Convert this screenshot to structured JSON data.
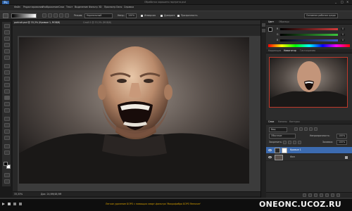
{
  "app": {
    "logo": "Ps",
    "title": "Обработка хорошего портрета.psd"
  },
  "window_controls": [
    "_",
    "□",
    "×"
  ],
  "menu": [
    "Файл",
    "Редактирование",
    "Изображение",
    "Слои",
    "Текст",
    "Выделение",
    "Фильтр",
    "3D",
    "Просмотр",
    "Окно",
    "Справка"
  ],
  "options_bar": {
    "mode_label": "Режим:",
    "mode_value": "Нормальный",
    "opacity_label": "Непр.:",
    "opacity_value": "100%",
    "reverse_label": "Инверсия",
    "dither_label": "Дизеринг",
    "transparency_label": "Прозрачность",
    "workspace": "Основная рабочая среда"
  },
  "document": {
    "tabs": [
      "portrait.psd @ 33,3% (Кривые 1, RGB/8)",
      "Слой 0 @ 33,3% (RGB/8)"
    ]
  },
  "status": {
    "zoom": "33,33%",
    "doc_info": "Док: 24,9M/48,9M"
  },
  "color_panel": {
    "tabs": [
      "Цвет",
      "Образцы"
    ],
    "channels": [
      {
        "label": "R",
        "value": "0",
        "color": "#d43b3b"
      },
      {
        "label": "G",
        "value": "0",
        "color": "#3cc43c"
      },
      {
        "label": "B",
        "value": "0",
        "color": "#3a5fd8"
      }
    ]
  },
  "adjust_panel": {
    "tabs": [
      "Коррекция",
      "Навигатор",
      "Гистограмма"
    ]
  },
  "layers_panel": {
    "tabs": [
      "Слои",
      "Каналы",
      "Контуры"
    ],
    "kind_filter": "Вид",
    "blend_mode": "Обычные",
    "opacity_label": "Непрозрачность:",
    "opacity_value": "100%",
    "lock_label": "Закрепить:",
    "fill_label": "Заливка:",
    "fill_value": "100%",
    "layers": [
      {
        "name": "Кривые 1",
        "selected": true
      },
      {
        "name": "Фон",
        "selected": false
      }
    ]
  },
  "taskbar": {
    "caption": "Легкое удаление БОРО с помощью смарт-фильтра 'Микрофибра БОРО Remover'",
    "watermark": "ONEONC.UCOZ.RU"
  },
  "colors": {
    "accent_blue": "#2d6bd0",
    "selected_layer": "#3c6bb0",
    "fg_swatch": "#000000",
    "bg_swatch": "#ffffff"
  }
}
